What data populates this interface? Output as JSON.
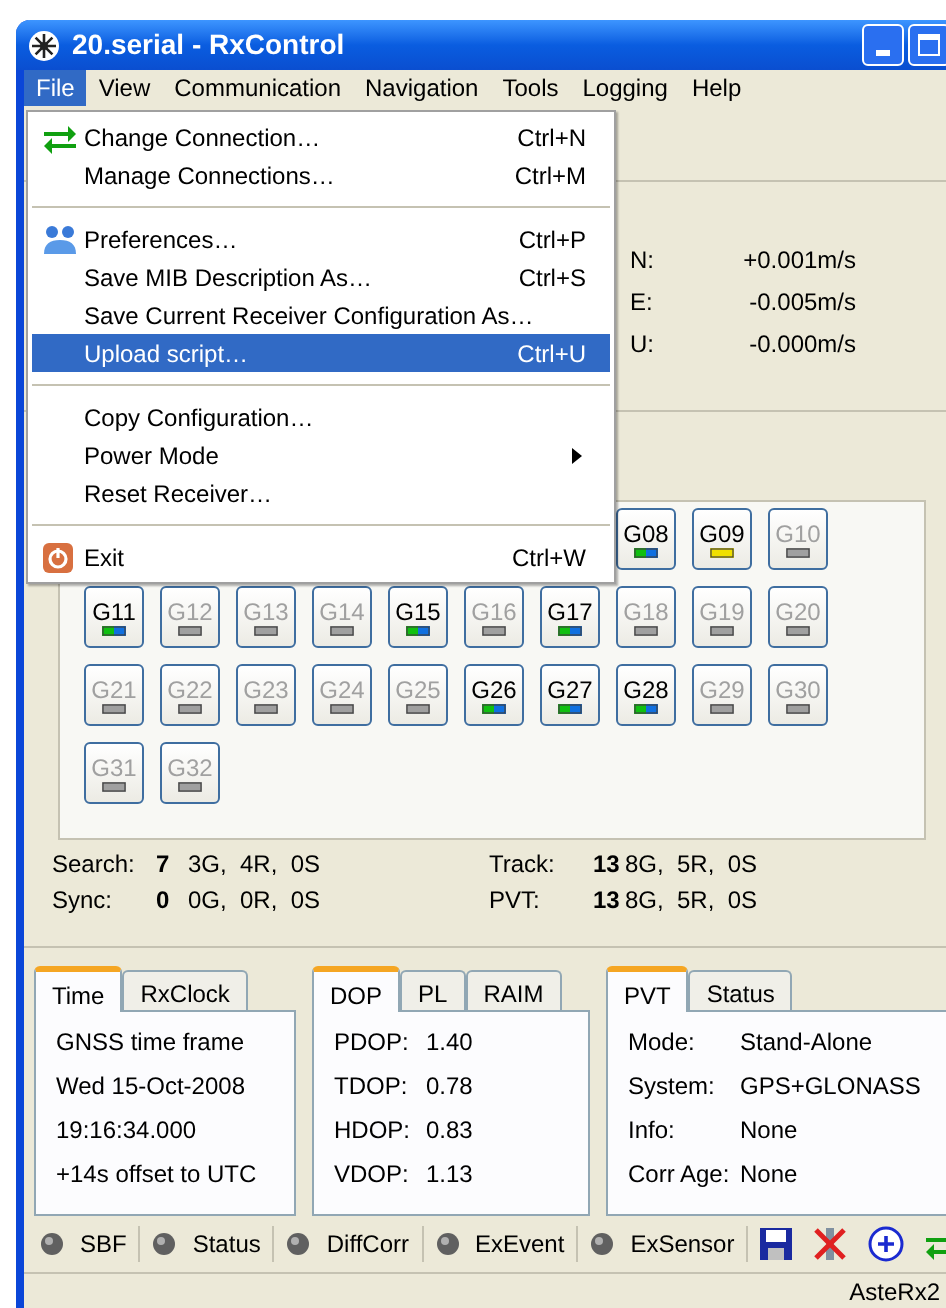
{
  "window": {
    "title": "20.serial - RxControl"
  },
  "menubar": [
    {
      "label": "File",
      "selected": true
    },
    {
      "label": "View",
      "selected": false
    },
    {
      "label": "Communication",
      "selected": false
    },
    {
      "label": "Navigation",
      "selected": false
    },
    {
      "label": "Tools",
      "selected": false
    },
    {
      "label": "Logging",
      "selected": false
    },
    {
      "label": "Help",
      "selected": false
    }
  ],
  "file_menu": [
    {
      "kind": "item",
      "label": "Change Connection…",
      "shortcut": "Ctrl+N",
      "selected": false
    },
    {
      "kind": "item",
      "label": "Manage Connections…",
      "shortcut": "Ctrl+M",
      "selected": false
    },
    {
      "kind": "separator"
    },
    {
      "kind": "item",
      "label": "Preferences…",
      "shortcut": "Ctrl+P",
      "selected": false
    },
    {
      "kind": "item",
      "label": "Save MIB Description As…",
      "shortcut": "Ctrl+S",
      "selected": false
    },
    {
      "kind": "item",
      "label": "Save Current Receiver Configuration As…",
      "selected": false
    },
    {
      "kind": "item",
      "label": "Upload script…",
      "shortcut": "Ctrl+U",
      "selected": true
    },
    {
      "kind": "separator"
    },
    {
      "kind": "item",
      "label": "Copy Configuration…",
      "selected": false
    },
    {
      "kind": "submenu",
      "label": "Power Mode",
      "selected": false
    },
    {
      "kind": "item",
      "label": "Reset Receiver…",
      "selected": false
    },
    {
      "kind": "separator"
    },
    {
      "kind": "item",
      "label": "Exit",
      "shortcut": "Ctrl+W",
      "selected": false
    }
  ],
  "velocity": [
    {
      "label": "N:",
      "value": "+0.001m/s"
    },
    {
      "label": "E:",
      "value": "-0.005m/s"
    },
    {
      "label": "U:",
      "value": "-0.000m/s"
    }
  ],
  "satellites": [
    [
      {
        "label": "G08",
        "kind": "tracked"
      },
      {
        "label": "G09",
        "kind": "searching"
      },
      {
        "label": "G10",
        "kind": "idle"
      }
    ],
    [
      {
        "label": "G11",
        "kind": "tracked"
      },
      {
        "label": "G12",
        "kind": "idle"
      },
      {
        "label": "G13",
        "kind": "idle"
      },
      {
        "label": "G14",
        "kind": "idle"
      },
      {
        "label": "G15",
        "kind": "tracked"
      },
      {
        "label": "G16",
        "kind": "idle"
      },
      {
        "label": "G17",
        "kind": "tracked"
      },
      {
        "label": "G18",
        "kind": "idle"
      },
      {
        "label": "G19",
        "kind": "idle"
      },
      {
        "label": "G20",
        "kind": "idle"
      }
    ],
    [
      {
        "label": "G21",
        "kind": "idle"
      },
      {
        "label": "G22",
        "kind": "idle"
      },
      {
        "label": "G23",
        "kind": "idle"
      },
      {
        "label": "G24",
        "kind": "idle"
      },
      {
        "label": "G25",
        "kind": "idle"
      },
      {
        "label": "G26",
        "kind": "tracked"
      },
      {
        "label": "G27",
        "kind": "tracked"
      },
      {
        "label": "G28",
        "kind": "tracked"
      },
      {
        "label": "G29",
        "kind": "idle"
      },
      {
        "label": "G30",
        "kind": "idle"
      }
    ],
    [
      {
        "label": "G31",
        "kind": "idle"
      },
      {
        "label": "G32",
        "kind": "idle"
      }
    ]
  ],
  "counts": [
    {
      "label": "Search:",
      "total": "7",
      "detail": "3G,  4R,  0S"
    },
    {
      "label": "Track:",
      "total": "13",
      "detail": "8G,  5R,  0S"
    },
    {
      "label": "Sync:",
      "total": "0",
      "detail": "0G,  0R,  0S"
    },
    {
      "label": "PVT:",
      "total": "13",
      "detail": "8G,  5R,  0S"
    }
  ],
  "panels": [
    {
      "tabs": [
        {
          "label": "Time",
          "selected": true
        },
        {
          "label": "RxClock",
          "selected": false
        }
      ],
      "rows": [
        {
          "text": "GNSS time frame"
        },
        {
          "text": "Wed 15-Oct-2008"
        },
        {
          "text": "19:16:34.000"
        },
        {
          "text": "+14s offset to UTC"
        }
      ]
    },
    {
      "tabs": [
        {
          "label": "DOP",
          "selected": true
        },
        {
          "label": "PL",
          "selected": false
        },
        {
          "label": "RAIM",
          "selected": false
        }
      ],
      "rows": [
        {
          "label": "PDOP:",
          "value": "1.40"
        },
        {
          "label": "TDOP:",
          "value": "0.78"
        },
        {
          "label": "HDOP:",
          "value": "0.83"
        },
        {
          "label": "VDOP:",
          "value": "1.13"
        }
      ]
    },
    {
      "tabs": [
        {
          "label": "PVT",
          "selected": true
        },
        {
          "label": "Status",
          "selected": false
        }
      ],
      "rows": [
        {
          "label": "Mode:",
          "value": "Stand-Alone"
        },
        {
          "label": "System:",
          "value": "GPS+GLONASS"
        },
        {
          "label": "Info:",
          "value": "None"
        },
        {
          "label": "Corr Age:",
          "value": "None"
        }
      ]
    }
  ],
  "indicators": [
    {
      "label": "SBF"
    },
    {
      "label": "Status"
    },
    {
      "label": "DiffCorr"
    },
    {
      "label": "ExEvent"
    },
    {
      "label": "ExSensor"
    }
  ],
  "receiver": "AsteRx2"
}
